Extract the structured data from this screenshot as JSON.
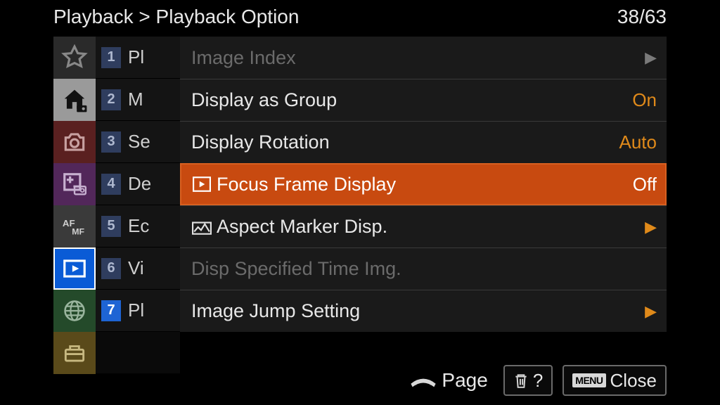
{
  "header": {
    "crumb1": "Playback",
    "sep": ">",
    "crumb2": "Playback Option",
    "page": "38/63"
  },
  "categories": [
    {
      "name": "favorites"
    },
    {
      "name": "home"
    },
    {
      "name": "shooting"
    },
    {
      "name": "exposure"
    },
    {
      "name": "focus"
    },
    {
      "name": "playback"
    },
    {
      "name": "network"
    },
    {
      "name": "setup"
    }
  ],
  "sub_items": [
    {
      "num": "1",
      "label": "Pl"
    },
    {
      "num": "2",
      "label": "M"
    },
    {
      "num": "3",
      "label": "Se"
    },
    {
      "num": "4",
      "label": "De"
    },
    {
      "num": "5",
      "label": "Ec"
    },
    {
      "num": "6",
      "label": "Vi"
    },
    {
      "num": "7",
      "label": "Pl",
      "active": true
    }
  ],
  "options": [
    {
      "label": "Image Index",
      "value": "",
      "arrow": "gray",
      "disabled": true
    },
    {
      "label": "Display as Group",
      "value": "On"
    },
    {
      "label": "Display Rotation",
      "value": "Auto"
    },
    {
      "label": "Focus Frame Display",
      "value": "Off",
      "selected": true,
      "icon": "focus-frame"
    },
    {
      "label": "Aspect Marker Disp.",
      "arrow": "orange",
      "icon": "aspect"
    },
    {
      "label": "Disp Specified Time Img.",
      "disabled": true
    },
    {
      "label": "Image Jump Setting",
      "arrow": "orange"
    }
  ],
  "footer": {
    "page_label": "Page",
    "help": "?",
    "menu_badge": "MENU",
    "close": "Close"
  }
}
